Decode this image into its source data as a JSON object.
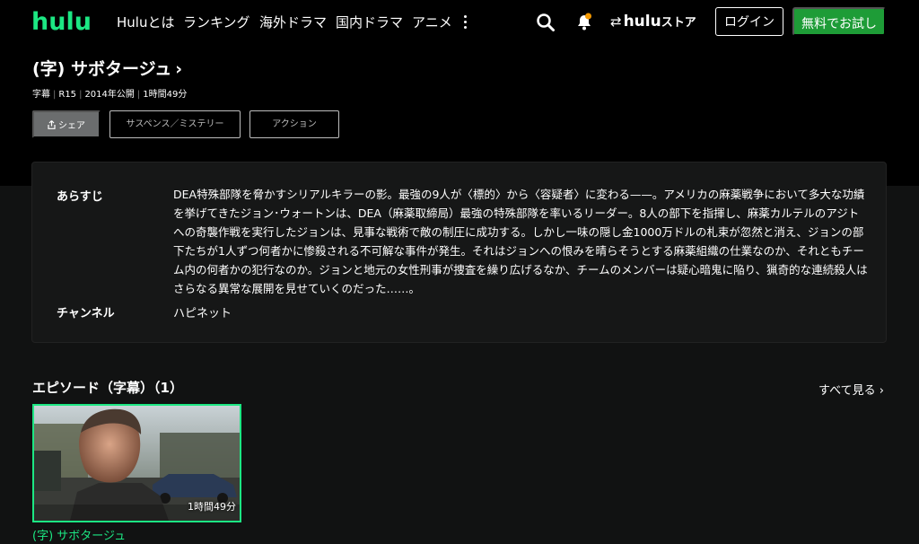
{
  "header": {
    "logo": "hulu",
    "nav": [
      "Huluとは",
      "ランキング",
      "海外ドラマ",
      "国内ドラマ",
      "アニメ"
    ],
    "store": {
      "swap": "⇄",
      "brand": "hulu",
      "suffix": "ストア"
    },
    "login_label": "ログイン",
    "trial_label": "無料でお試し",
    "notification_color": "#f39800"
  },
  "program": {
    "title": "(字) サボタージュ",
    "chevron": "›",
    "meta": [
      "字幕",
      "R15",
      "2014年公開",
      "1時間49分"
    ],
    "meta_sep": "|",
    "share_label": "シェア",
    "share_icon": "share-icon",
    "genres": [
      "サスペンス／ミステリー",
      "アクション"
    ]
  },
  "info": {
    "synopsis_label": "あらすじ",
    "synopsis": "DEA特殊部隊を脅かすシリアルキラーの影。最強の9人が〈標的〉から〈容疑者〉に変わる——。アメリカの麻薬戦争において多大な功績を挙げてきたジョン･ウォートンは、DEA（麻薬取締局）最強の特殊部隊を率いるリーダー。8人の部下を指揮し、麻薬カルテルのアジトへの奇襲作戦を実行したジョンは、見事な戦術で敵の制圧に成功する。しかし一味の隠し金1000万ドルの札束が忽然と消え、ジョンの部下たちが1人ずつ何者かに惨殺される不可解な事件が発生。それはジョンへの恨みを晴らそうとする麻薬組織の仕業なのか、それともチーム内の何者かの犯行なのか。ジョンと地元の女性刑事が捜査を繰り広げるなか、チームのメンバーは疑心暗鬼に陥り、猟奇的な連続殺人はさらなる異常な展開を見せていくのだった……。",
    "channel_label": "チャンネル",
    "channel_value": "ハピネット"
  },
  "episodes": {
    "heading": "エピソード（字幕）（1）",
    "see_all": "すべて見る ›",
    "items": [
      {
        "title": "(字) サボタージュ",
        "duration": "1時間49分"
      }
    ]
  },
  "colors": {
    "accent": "#1ce783",
    "trial": "#1e9c37",
    "background": "#111212"
  }
}
